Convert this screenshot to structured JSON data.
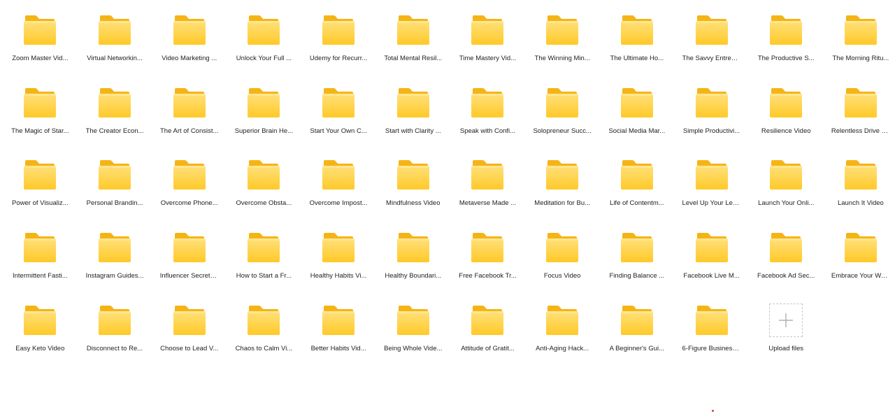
{
  "folders": [
    "Zoom Master Vid...",
    "Virtual Networkin...",
    "Video Marketing ...",
    "Unlock Your Full ...",
    "Udemy for Recurr...",
    "Total Mental Resil...",
    "Time Mastery Vid...",
    "The Winning Min...",
    "The Ultimate Ho...",
    "The Savvy Entrepr...",
    "The Productive S...",
    "The Morning Ritu...",
    "The Magic of Star...",
    "The Creator Econ...",
    "The Art of Consist...",
    "Superior Brain He...",
    "Start Your Own C...",
    "Start with Clarity ...",
    "Speak with Confi...",
    "Solopreneur Succ...",
    "Social Media Mar...",
    "Simple Productivi...",
    "Resilience Video",
    "Relentless Drive V...",
    "Power of Visualiz...",
    "Personal Brandin...",
    "Overcome Phone...",
    "Overcome Obsta...",
    "Overcome Impost...",
    "Mindfulness Video",
    "Metaverse Made ...",
    "Meditation for Bu...",
    "Life of Contentm...",
    "Level Up Your Lea...",
    "Launch Your Onli...",
    "Launch It Video",
    "Intermittent Fasti...",
    "Instagram Guides...",
    "Influencer Secrets...",
    "How to Start a Fr...",
    "Healthy Habits Vi...",
    "Healthy Boundari...",
    "Free Facebook Tr...",
    "Focus Video",
    "Finding Balance ...",
    "Facebook Live M...",
    "Facebook Ad Sec...",
    "Embrace Your We...",
    "Easy Keto Video",
    "Disconnect to Re...",
    "Choose to Lead V...",
    "Chaos to Calm Vi...",
    "Better Habits Vid...",
    "Being Whole Vide...",
    "Attitude of Gratit...",
    "Anti-Aging Hack...",
    "A Beginner's Gui...",
    "6-Figure Business..."
  ],
  "upload": {
    "label": "Upload files",
    "icon": "plus-icon"
  },
  "colors": {
    "folder_front": "#FFD24A",
    "folder_back": "#F5B416",
    "label_text": "#222222",
    "upload_border": "#c8c8c8",
    "upload_plus": "#b0b0b0",
    "dot": "#e53935"
  }
}
